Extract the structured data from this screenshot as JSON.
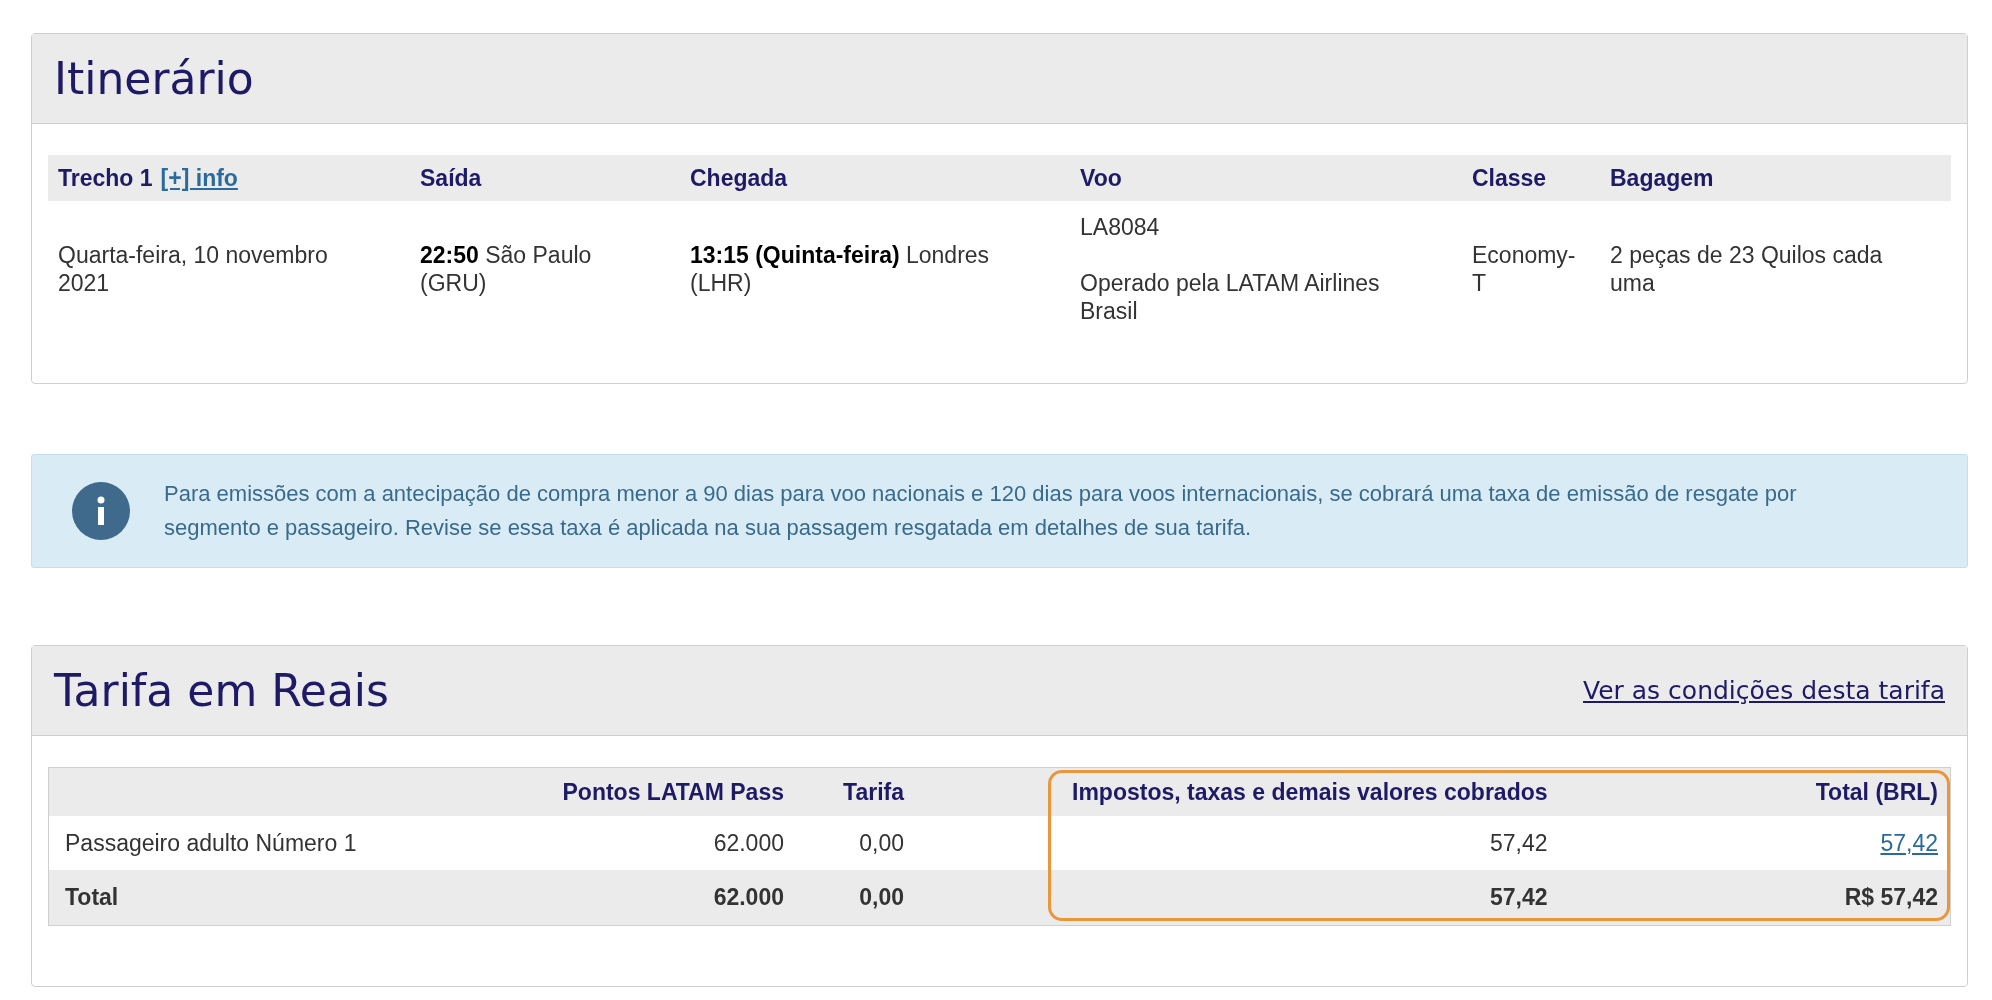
{
  "itinerary": {
    "title": "Itinerário",
    "columns": [
      {
        "label": "Trecho 1",
        "link": "[+] info"
      },
      {
        "label": "Saída"
      },
      {
        "label": "Chegada"
      },
      {
        "label": "Voo"
      },
      {
        "label": "Classe"
      },
      {
        "label": "Bagagem"
      }
    ],
    "leg": {
      "date": "Quarta-feira, 10 novembro 2021",
      "departure": "**22:50** São Paulo (GRU)",
      "arrival": "**13:15 (Quinta-feira)** Londres (LHR)",
      "flight": "LA8084",
      "operator": "Operado pela LATAM Airlines Brasil",
      "class": "Economy-T",
      "baggage": "2 peças de 23 Quilos cada uma"
    }
  },
  "notice": {
    "text": "Para emissões com a antecipação de compra menor a 90 dias para voo nacionais e 120 dias para voos internacionais, se cobrará uma taxa de emissão de resgate por segmento e passageiro. Revise se essa taxa é aplicada na sua passagem resgatada em detalhes de sua tarifa."
  },
  "fare": {
    "title": "Tarifa em Reais",
    "conditions_link": "Ver as condições desta tarifa",
    "columns": [
      {
        "label": "Pontos LATAM Pass",
        "highlighted": false
      },
      {
        "label": "Tarifa",
        "highlighted": false
      },
      {
        "label": "Impostos, taxas e demais valores cobrados",
        "highlighted": true
      },
      {
        "label": "Total (BRL)",
        "highlighted": true
      }
    ],
    "rows": [
      {
        "kind": "passenger",
        "label": "Passageiro adulto Número 1",
        "values": [
          "62.000",
          "0,00",
          "57,42",
          "57,42"
        ]
      },
      {
        "kind": "total",
        "label": "Total",
        "values": [
          "62.000",
          "0,00",
          "57,42",
          "R$ 57,42"
        ]
      }
    ]
  }
}
